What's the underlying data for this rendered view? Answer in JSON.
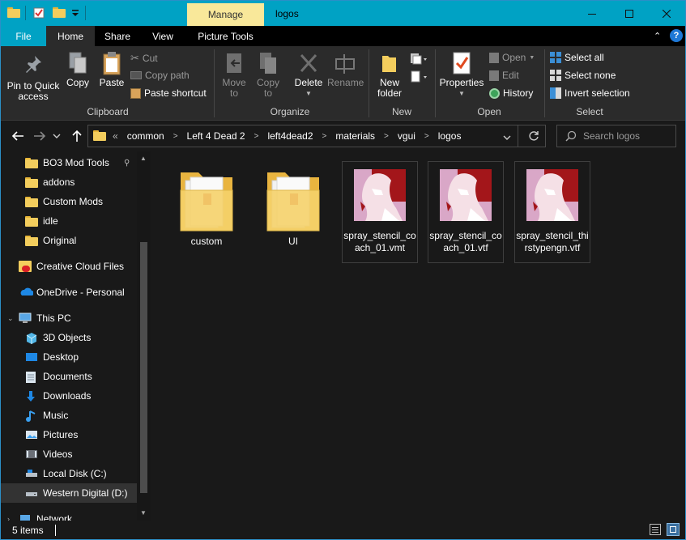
{
  "window": {
    "title": "logos",
    "context_tab": "Manage",
    "qat_icons": [
      "folder-icon",
      "properties-check-icon",
      "new-folder-icon",
      "qat-dropdown-icon"
    ],
    "controls": {
      "minimize": "—",
      "maximize": "☐",
      "close": "✕"
    }
  },
  "tabs": {
    "file": "File",
    "home": "Home",
    "share": "Share",
    "view": "View",
    "picture_tools": "Picture Tools"
  },
  "ribbon": {
    "clipboard": {
      "label": "Clipboard",
      "pin": "Pin to Quick access",
      "copy": "Copy",
      "paste": "Paste",
      "cut": "Cut",
      "copy_path": "Copy path",
      "paste_shortcut": "Paste shortcut"
    },
    "organize": {
      "label": "Organize",
      "move_to": "Move to",
      "copy_to": "Copy to",
      "delete": "Delete",
      "rename": "Rename"
    },
    "new": {
      "label": "New",
      "new_folder": "New folder"
    },
    "open": {
      "label": "Open",
      "properties": "Properties",
      "open": "Open",
      "edit": "Edit",
      "history": "History"
    },
    "select": {
      "label": "Select",
      "select_all": "Select all",
      "select_none": "Select none",
      "invert": "Invert selection"
    }
  },
  "address": {
    "overflow": "«",
    "crumbs": [
      "common",
      "Left 4 Dead 2",
      "left4dead2",
      "materials",
      "vgui",
      "logos"
    ],
    "search_placeholder": "Search logos"
  },
  "nav_pane": {
    "items": [
      {
        "label": "BO3 Mod Tools",
        "icon": "folder-icon",
        "pinned": true
      },
      {
        "label": "addons",
        "icon": "folder-icon"
      },
      {
        "label": "Custom Mods",
        "icon": "folder-icon"
      },
      {
        "label": "idle",
        "icon": "folder-icon"
      },
      {
        "label": "Original",
        "icon": "folder-icon"
      },
      {
        "label": "Creative Cloud Files",
        "icon": "creative-cloud-icon"
      },
      {
        "label": "OneDrive - Personal",
        "icon": "onedrive-icon"
      },
      {
        "label": "This PC",
        "icon": "this-pc-icon"
      },
      {
        "label": "3D Objects",
        "icon": "3d-objects-icon"
      },
      {
        "label": "Desktop",
        "icon": "desktop-icon"
      },
      {
        "label": "Documents",
        "icon": "documents-icon"
      },
      {
        "label": "Downloads",
        "icon": "downloads-icon"
      },
      {
        "label": "Music",
        "icon": "music-icon"
      },
      {
        "label": "Pictures",
        "icon": "pictures-icon"
      },
      {
        "label": "Videos",
        "icon": "videos-icon"
      },
      {
        "label": "Local Disk (C:)",
        "icon": "local-disk-icon"
      },
      {
        "label": "Western Digital (D:)",
        "icon": "drive-icon",
        "selected": true
      },
      {
        "label": "Network",
        "icon": "network-icon"
      }
    ]
  },
  "files": [
    {
      "name": "custom",
      "type": "folder"
    },
    {
      "name": "UI",
      "type": "folder"
    },
    {
      "name": "spray_stencil_coach_01.vmt",
      "type": "image"
    },
    {
      "name": "spray_stencil_coach_01.vtf",
      "type": "image"
    },
    {
      "name": "spray_stencil_thirstypengn.vtf",
      "type": "image"
    }
  ],
  "status": {
    "count": "5 items"
  },
  "colors": {
    "accent": "#00a2c4",
    "manage": "#f9e89a",
    "folder": "#f3cd5d",
    "background": "#191919",
    "ribbon": "#2b2b2b"
  }
}
